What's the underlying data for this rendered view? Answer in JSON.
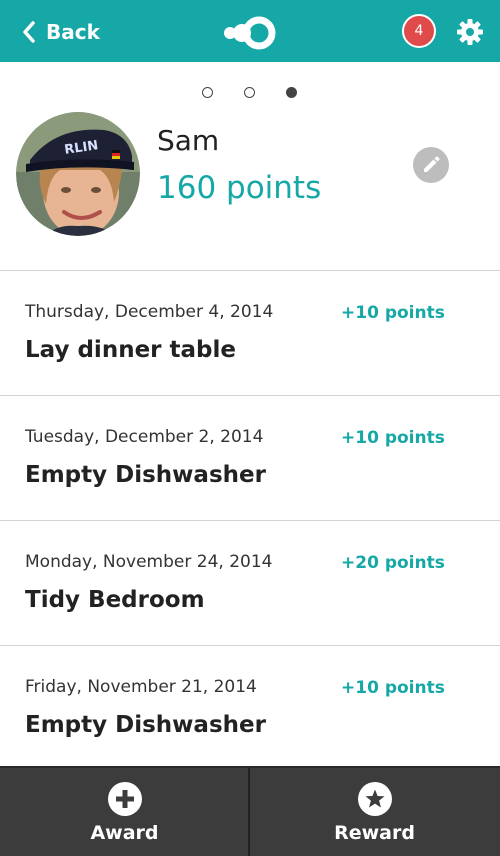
{
  "header": {
    "back_label": "Back",
    "notification_count": "4",
    "brand_color": "#15a8a6",
    "badge_color": "#e04a4a"
  },
  "pager": {
    "total": 3,
    "active_index": 2
  },
  "profile": {
    "name": "Sam",
    "points": "160 points"
  },
  "history": [
    {
      "date": "Thursday, December 4, 2014",
      "points": "+10 points",
      "title": "Lay dinner table"
    },
    {
      "date": "Tuesday, December 2, 2014",
      "points": "+10 points",
      "title": "Empty Dishwasher"
    },
    {
      "date": "Monday, November 24, 2014",
      "points": "+20 points",
      "title": "Tidy Bedroom"
    },
    {
      "date": "Friday, November 21, 2014",
      "points": "+10 points",
      "title": "Empty Dishwasher"
    }
  ],
  "bottom_bar": {
    "award_label": "Award",
    "reward_label": "Reward"
  },
  "icons": [
    "back-chevron-icon",
    "app-logo-icon",
    "gear-icon",
    "pencil-icon",
    "plus-icon",
    "star-icon"
  ]
}
